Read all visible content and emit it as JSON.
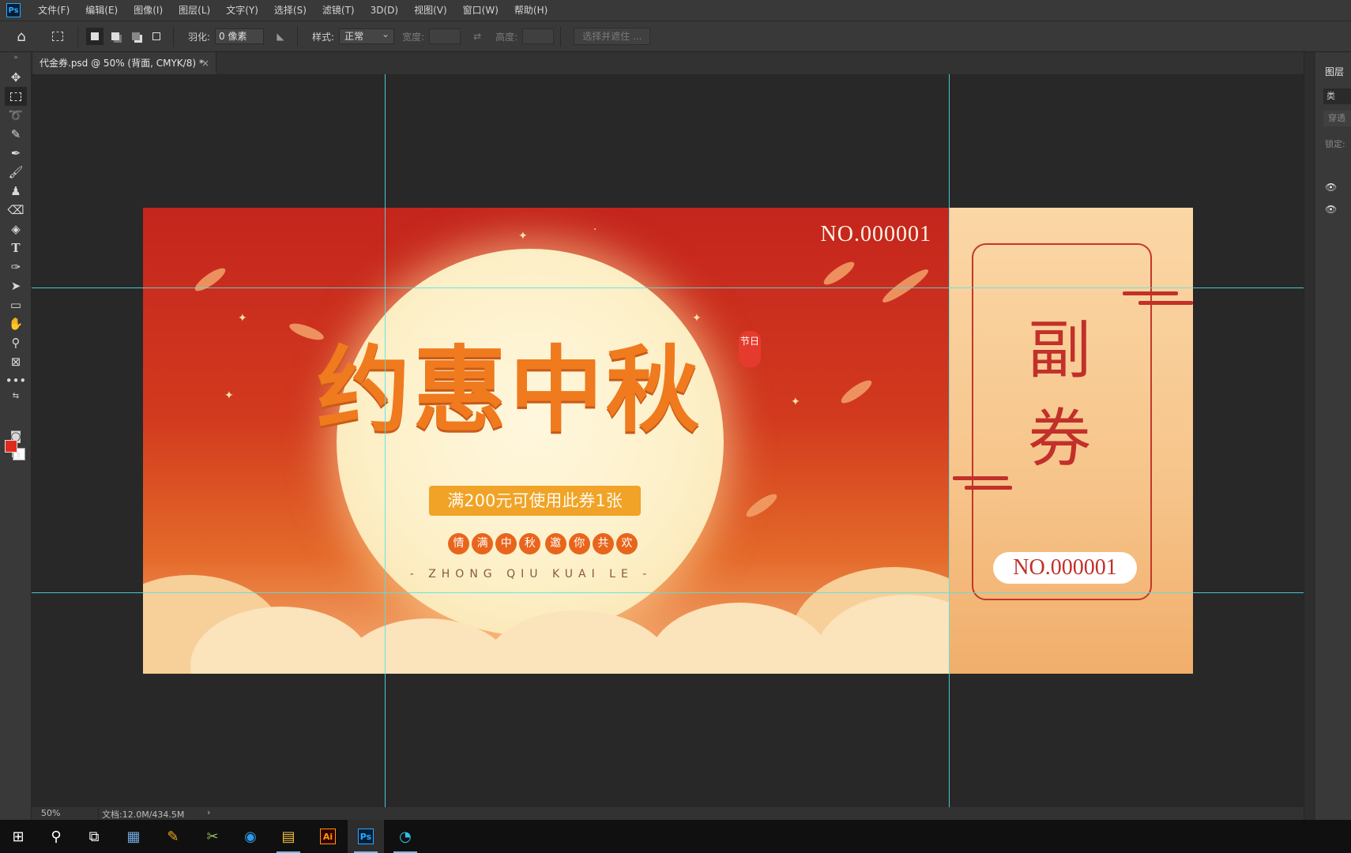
{
  "menubar": {
    "app_icon": "Ps",
    "items": [
      "文件(F)",
      "编辑(E)",
      "图像(I)",
      "图层(L)",
      "文字(Y)",
      "选择(S)",
      "滤镜(T)",
      "3D(D)",
      "视图(V)",
      "窗口(W)",
      "帮助(H)"
    ]
  },
  "options": {
    "feather_label": "羽化:",
    "feather_value": "0 像素",
    "style_label": "样式:",
    "style_value": "正常",
    "width_label": "宽度:",
    "height_label": "高度:",
    "select_mask_button": "选择并遮住 ..."
  },
  "document_tab": {
    "title": "代金券.psd @ 50% (背面, CMYK/8) *",
    "close": "×"
  },
  "artwork": {
    "main_number": "NO.000001",
    "title": "约惠中秋",
    "seal_text": "节日",
    "banner_text": "满200元可使用此券1张",
    "circles": [
      "情",
      "满",
      "中",
      "秋",
      "邀",
      "你",
      "共",
      "欢"
    ],
    "pinyin": "- ZHONG QIU KUAI LE -",
    "stub_title_1": "副",
    "stub_title_2": "券",
    "stub_number": "NO.000001"
  },
  "statusbar": {
    "zoom": "50%",
    "doc_size": "文档:12.0M/434.5M",
    "arrow": "›"
  },
  "right_panel": {
    "title": "图层",
    "search": "类",
    "blend": "穿透",
    "lock": "锁定:"
  },
  "colors": {
    "foreground": "#e22a1c",
    "background": "#ffffff",
    "guide": "#4ee3ea",
    "coupon_red": "#c4251d",
    "title_orange": "#f07a1e"
  },
  "taskbar": {
    "apps": [
      "windows-start-icon",
      "search-icon",
      "task-view-icon",
      "calculator-icon",
      "paint-icon",
      "app-icon",
      "browser-icon",
      "file-explorer-icon",
      "illustrator-icon",
      "photoshop-icon",
      "chat-icon"
    ],
    "ai_label": "Ai",
    "ps_label": "Ps"
  }
}
